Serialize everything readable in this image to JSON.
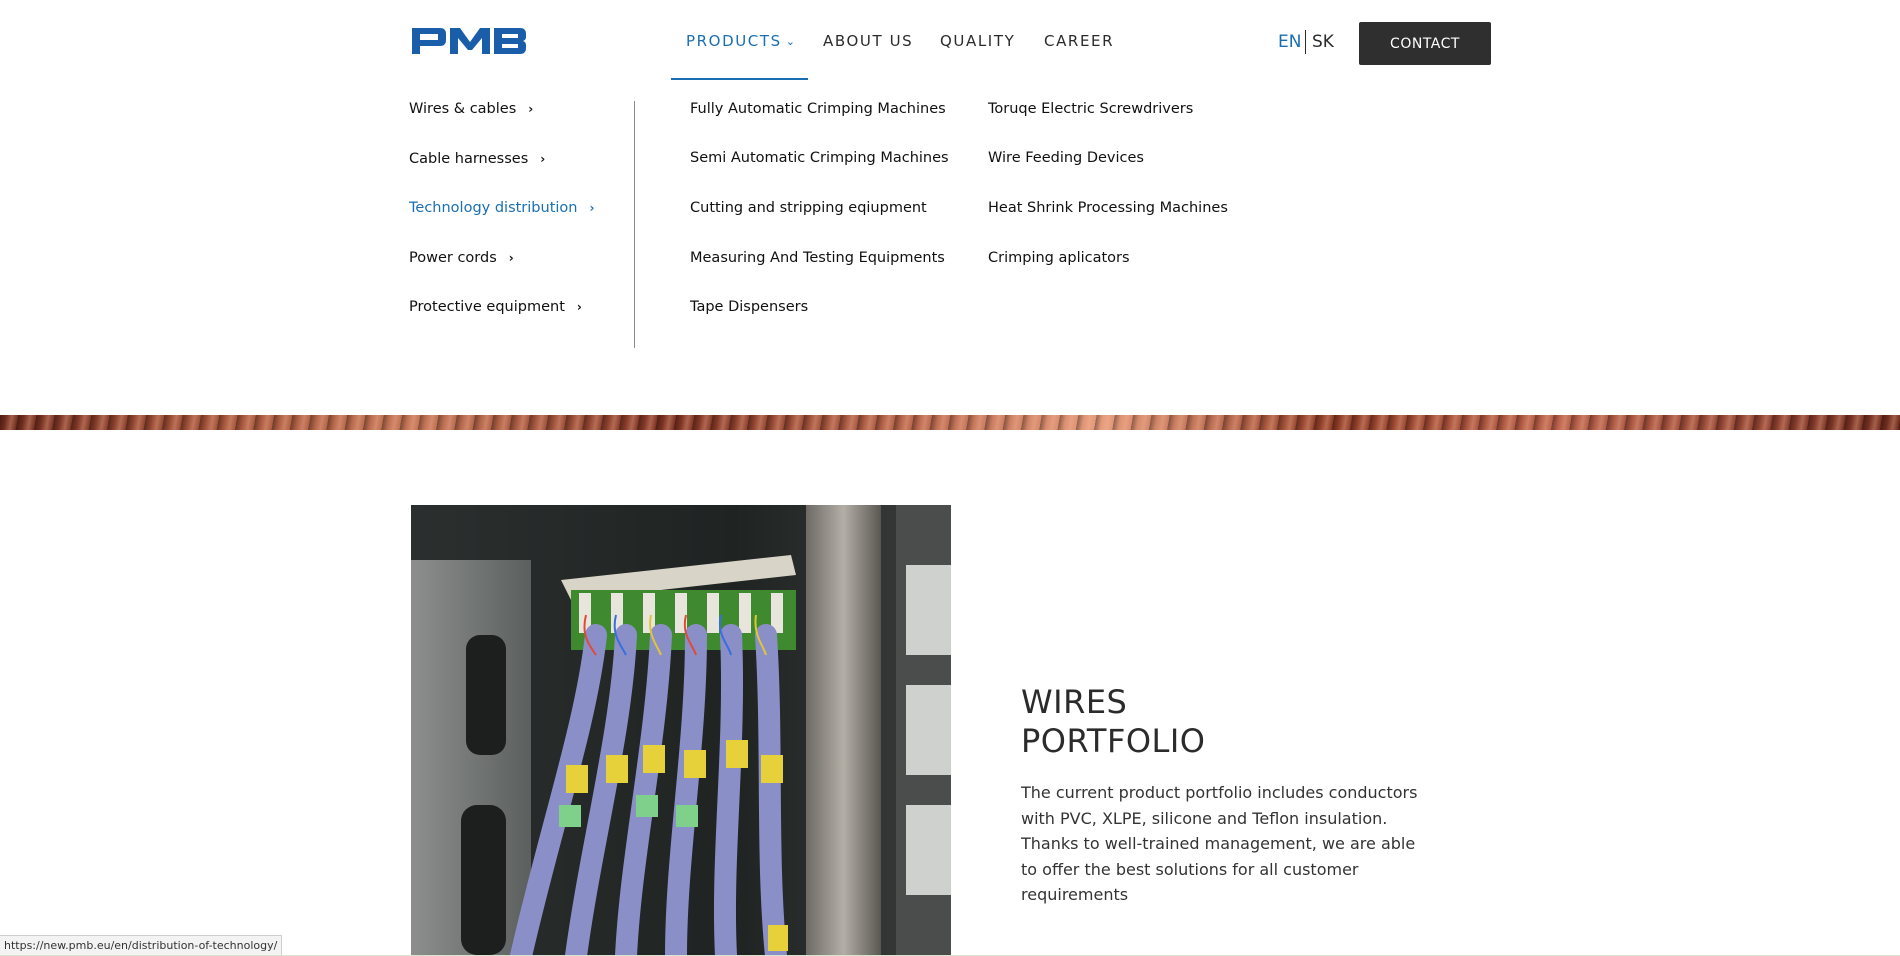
{
  "logo": {
    "text": "PMB",
    "color": "#1a5da8"
  },
  "nav": {
    "items": [
      {
        "label": "PRODUCTS",
        "active": true
      },
      {
        "label": "ABOUT US",
        "active": false
      },
      {
        "label": "QUALITY",
        "active": false
      },
      {
        "label": "CAREER",
        "active": false
      }
    ]
  },
  "languages": [
    {
      "code": "EN",
      "active": true
    },
    {
      "code": "SK",
      "active": false
    }
  ],
  "contact_button": "CONTACT",
  "mega_menu": {
    "categories": [
      {
        "label": "Wires & cables",
        "active": false
      },
      {
        "label": "Cable harnesses",
        "active": false
      },
      {
        "label": "Technology distribution",
        "active": true
      },
      {
        "label": "Power cords",
        "active": false
      },
      {
        "label": "Protective equipment",
        "active": false
      }
    ],
    "subcategories_col1": [
      "Fully Automatic Crimping Machines",
      "Semi Automatic Crimping Machines",
      "Cutting and stripping eqiupment",
      "Measuring And Testing Equipments",
      "Tape Dispensers"
    ],
    "subcategories_col2": [
      "Toruqe Electric Screwdrivers",
      "Wire Feeding Devices",
      "Heat Shrink Processing Machines",
      "Crimping aplicators"
    ]
  },
  "section": {
    "heading_line1": "WIRES",
    "heading_line2": "PORTFOLIO",
    "body_line1": "The current product portfolio includes conductors",
    "body_line2": "with PVC, XLPE, silicone and Teflon insulation.",
    "body_line3": "Thanks to well-trained management, we are able",
    "body_line4": "to offer the best solutions for all customer",
    "body_line5": "requirements"
  },
  "status_bar_url": "https://new.pmb.eu/en/distribution-of-technology/",
  "colors": {
    "accent": "#1a6fb3",
    "button_bg": "#2f2f2f"
  }
}
